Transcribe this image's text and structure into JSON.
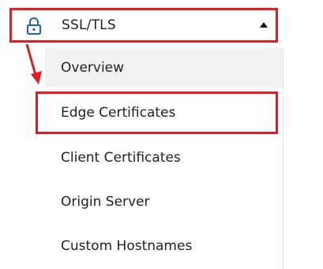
{
  "nav": {
    "section_label": "SSL/TLS",
    "section_icon": "lock-icon",
    "expanded": true,
    "items": [
      {
        "label": "Overview",
        "active": true
      },
      {
        "label": "Edge Certificates",
        "highlighted": true
      },
      {
        "label": "Client Certificates"
      },
      {
        "label": "Origin Server"
      },
      {
        "label": "Custom Hostnames"
      }
    ]
  },
  "colors": {
    "annotation_red": "#e41b23",
    "icon_blue": "#1f5fbf",
    "active_bg": "#f2f2f2",
    "text": "#222222"
  }
}
